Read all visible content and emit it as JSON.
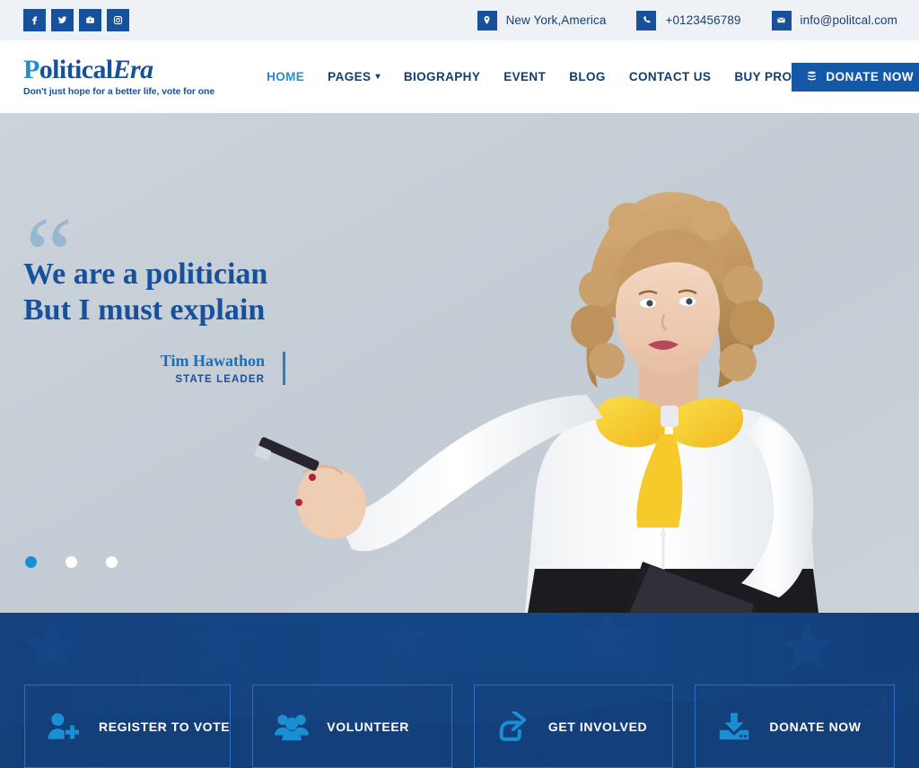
{
  "topbar": {
    "social": [
      {
        "name": "facebook-icon",
        "label": "Facebook"
      },
      {
        "name": "twitter-icon",
        "label": "Twitter"
      },
      {
        "name": "youtube-icon",
        "label": "YouTube"
      },
      {
        "name": "instagram-icon",
        "label": "Instagram"
      }
    ],
    "contacts": [
      {
        "icon": "location-pin-icon",
        "text": "New York,America"
      },
      {
        "icon": "phone-icon",
        "text": "+0123456789"
      },
      {
        "icon": "envelope-icon",
        "text": "info@politcal.com"
      }
    ]
  },
  "header": {
    "logo": {
      "part1": "P",
      "part2": "olitical",
      "part3": "Era",
      "tagline": "Don't just hope for a better life, vote for one"
    },
    "nav": [
      {
        "label": "HOME",
        "active": true,
        "caret": false
      },
      {
        "label": "PAGES",
        "active": false,
        "caret": true
      },
      {
        "label": "BIOGRAPHY",
        "active": false,
        "caret": false
      },
      {
        "label": "EVENT",
        "active": false,
        "caret": false
      },
      {
        "label": "BLOG",
        "active": false,
        "caret": false
      },
      {
        "label": "CONTACT US",
        "active": false,
        "caret": false
      },
      {
        "label": "BUY PRO",
        "active": false,
        "caret": false
      }
    ],
    "donate_label": "DONATE NOW"
  },
  "hero": {
    "quote_glyph": "“",
    "title": "We are a politician But I must explain",
    "author_name": "Tim Hawathon",
    "author_role": "STATE LEADER",
    "slides": [
      {
        "active": true
      },
      {
        "active": false
      },
      {
        "active": false
      }
    ]
  },
  "cta": {
    "cards": [
      {
        "icon": "user-plus-icon",
        "label": "REGISTER TO VOTE"
      },
      {
        "icon": "people-group-icon",
        "label": "VOLUNTEER"
      },
      {
        "icon": "share-arrow-icon",
        "label": "GET INVOLVED"
      },
      {
        "icon": "download-inbox-icon",
        "label": "DONATE NOW"
      }
    ]
  },
  "colors": {
    "brand_navy": "#17509b",
    "brand_blue": "#1a8fd4",
    "topbar_bg": "#eef2f7",
    "cta_bg": "#143f7f",
    "hero_bg": "#c8ced6",
    "accent_yellow": "#f6cf2e"
  }
}
